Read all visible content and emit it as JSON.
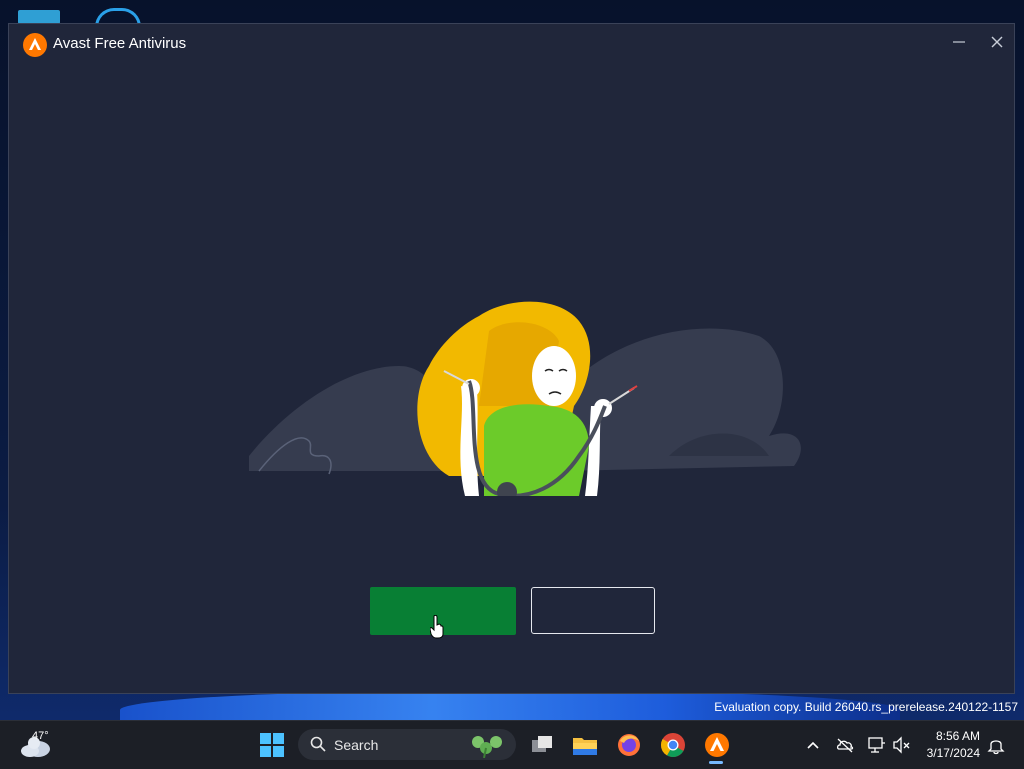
{
  "window": {
    "title": "Avast Free Antivirus",
    "minimize_icon": "minimize-icon",
    "close_icon": "close-icon"
  },
  "dialog": {
    "primary_button_label": "",
    "secondary_button_label": "",
    "primary_color": "#087f34",
    "illustration": "woman-holding-unplugged-cable"
  },
  "watermark": {
    "text": "Evaluation copy. Build 26040.rs_prerelease.240122-1157"
  },
  "taskbar": {
    "weather_temp": "47°",
    "search_placeholder": "Search",
    "apps": [
      "start-icon",
      "task-view-icon",
      "file-explorer-icon",
      "firefox-icon",
      "chrome-icon",
      "avast-icon"
    ],
    "tray": [
      "chevron-up-icon",
      "onedrive-icon",
      "network-icon",
      "volume-muted-icon",
      "bell-icon"
    ],
    "time": "8:56 AM",
    "date": "3/17/2024"
  },
  "colors": {
    "window_bg": "#20263a",
    "taskbar_bg": "#1c1f26",
    "accent": "#ff7800"
  }
}
